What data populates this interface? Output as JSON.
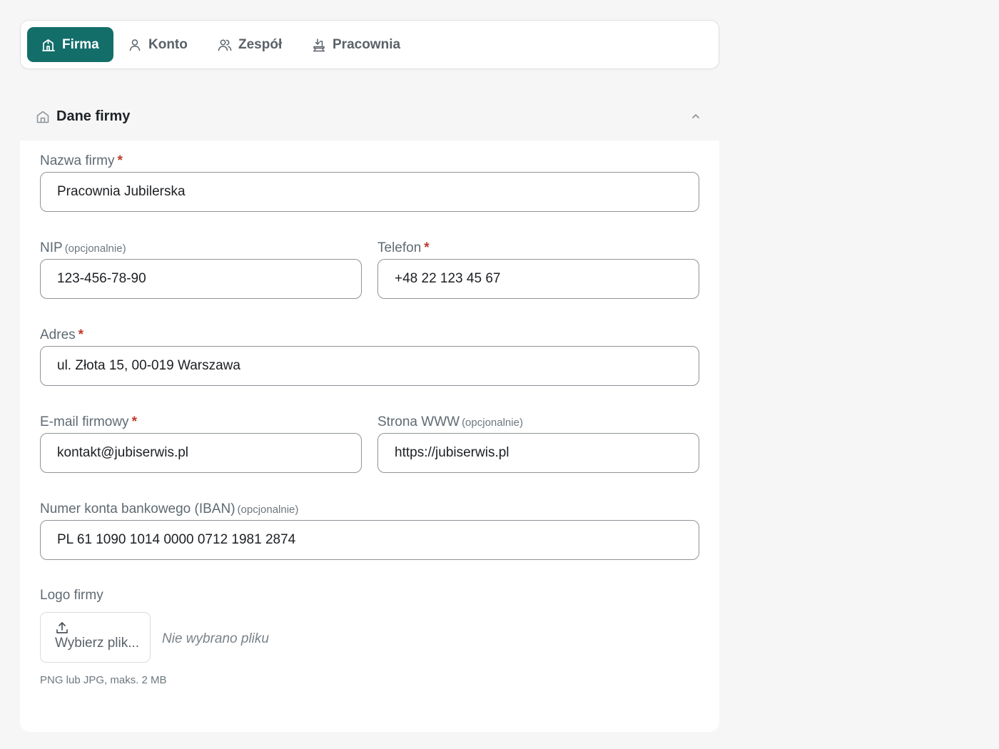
{
  "tabs": [
    {
      "label": "Firma",
      "icon": "building-icon",
      "active": true
    },
    {
      "label": "Konto",
      "icon": "user-icon",
      "active": false
    },
    {
      "label": "Zespół",
      "icon": "users-icon",
      "active": false
    },
    {
      "label": "Pracownia",
      "icon": "workbench-icon",
      "active": false
    }
  ],
  "section": {
    "title": "Dane firmy",
    "icon": "home-icon",
    "collapse_icon": "chevron-up-icon"
  },
  "form": {
    "company_name": {
      "label": "Nazwa firmy",
      "required": "*",
      "value": "Pracownia Jubilerska"
    },
    "nip": {
      "label": "NIP",
      "optional": "(opcjonalnie)",
      "value": "123-456-78-90"
    },
    "phone": {
      "label": "Telefon",
      "required": "*",
      "value": "+48 22 123 45 67"
    },
    "address": {
      "label": "Adres",
      "required": "*",
      "value": "ul. Złota 15, 00-019 Warszawa"
    },
    "email": {
      "label": "E-mail firmowy",
      "required": "*",
      "value": "kontakt@jubiserwis.pl"
    },
    "website": {
      "label": "Strona WWW",
      "optional": "(opcjonalnie)",
      "value": "https://jubiserwis.pl"
    },
    "iban": {
      "label": "Numer konta bankowego (IBAN)",
      "optional": "(opcjonalnie)",
      "value": "PL 61 1090 1014 0000 0712 1981 2874"
    },
    "logo": {
      "label": "Logo firmy",
      "button_label": "Wybierz plik...",
      "button_icon": "upload-icon",
      "status": "Nie wybrano pliku",
      "hint": "PNG lub JPG, maks. 2 MB"
    }
  },
  "colors": {
    "accent": "#136e6a",
    "required": "#c0392b",
    "background": "#f5f6f5"
  }
}
